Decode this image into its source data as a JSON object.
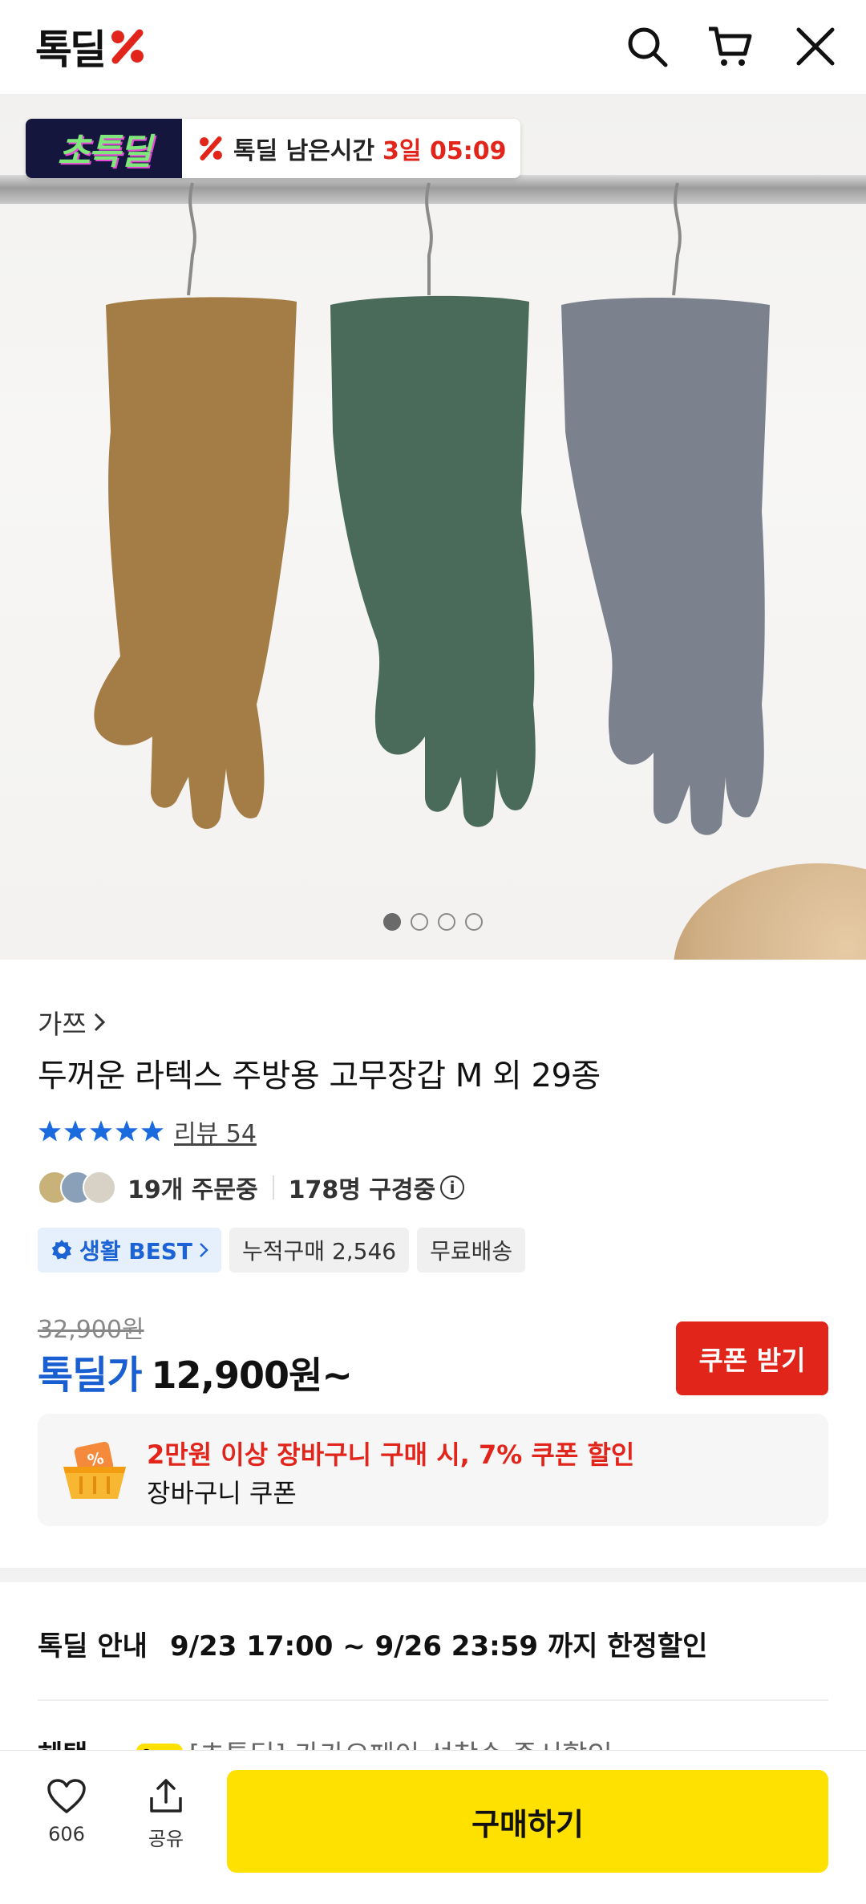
{
  "header": {
    "logo_text": "톡딜",
    "icons": [
      "search-icon",
      "cart-icon",
      "close-icon"
    ]
  },
  "hero": {
    "badge_label": "초특딜",
    "timer_label": "톡딜 남은시간",
    "timer_value": "3일 05:09",
    "page_indicator": {
      "total": 4,
      "active": 1
    }
  },
  "product": {
    "brand": "가쯔",
    "title": "두꺼운 라텍스 주방용 고무장갑 M 외 29종",
    "rating_stars": 5,
    "review_label": "리뷰 54",
    "orders_text": "19개 주문중",
    "viewers_text": "178명 구경중",
    "chips": {
      "best": "생활 BEST",
      "cumulative": "누적구매 2,546",
      "shipping": "무료배송"
    },
    "original_price": "32,900원",
    "price_label": "톡딜가",
    "price_value": "12,900원~",
    "coupon_button": "쿠폰 받기",
    "cart_coupon": {
      "main": "2만원 이상 장바구니 구매 시, 7% 쿠폰 할인",
      "sub": "장바구니 쿠폰"
    }
  },
  "deal_info": {
    "label": "톡딜 안내",
    "text": "9/23 17:00 ~ 9/26 23:59 까지 한정할인"
  },
  "benefit": {
    "label": "혜택",
    "pay_badge": "●pay",
    "text": "[초톡딜] 카카오페이 선착순 즉시할인"
  },
  "bottom_bar": {
    "like_count": "606",
    "share_label": "공유",
    "buy_label": "구매하기"
  },
  "colors": {
    "brand_red": "#e1251b",
    "price_blue": "#1a5fd1",
    "buy_yellow": "#ffe100",
    "glove_brown": "#a47c45",
    "glove_green": "#4a6a5a",
    "glove_gray": "#7c828d"
  }
}
